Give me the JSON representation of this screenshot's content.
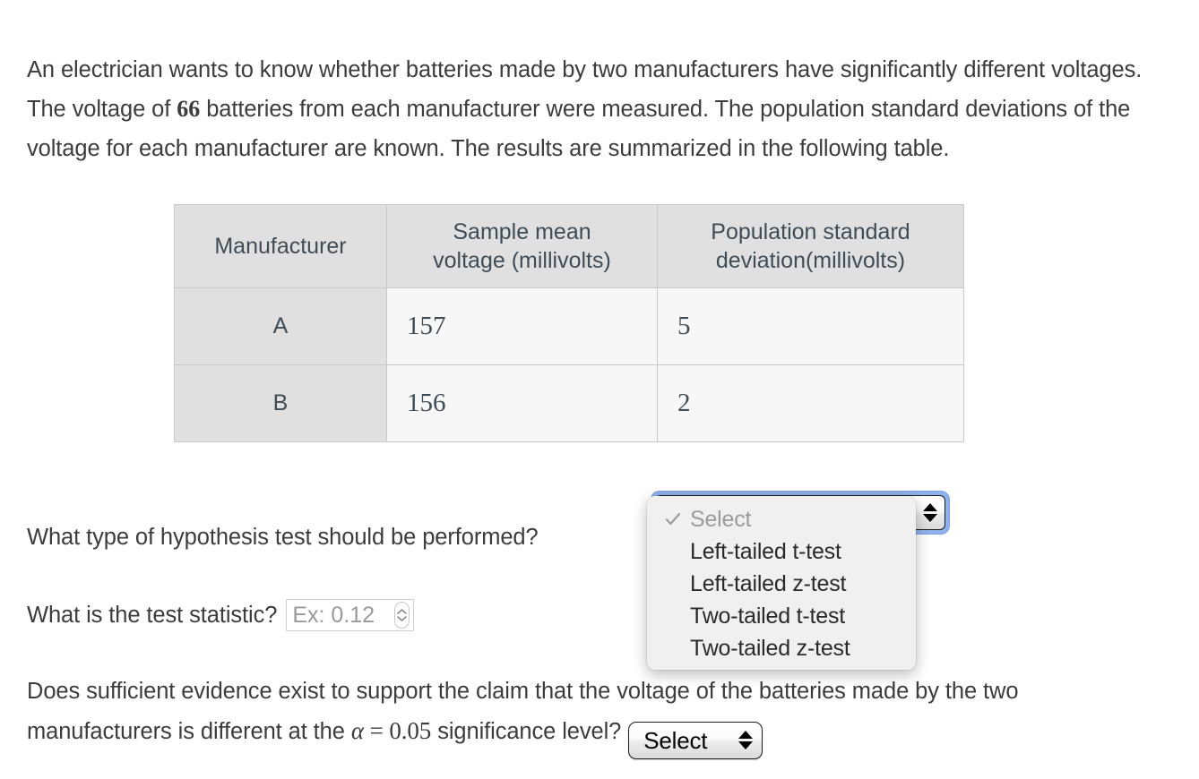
{
  "intro": {
    "part1": "An electrician wants to know whether batteries made by two manufacturers have significantly different voltages. The voltage of ",
    "sample_size": "66",
    "part2": " batteries from each manufacturer were measured. The population standard deviations of the voltage for each manufacturer are known. The results are summarized in the following table."
  },
  "table": {
    "headers": [
      "Manufacturer",
      "Sample mean voltage (millivolts)",
      "Population standard deviation(millivolts)"
    ],
    "header_lines": {
      "col1": "Manufacturer",
      "col2_line1": "Sample mean",
      "col2_line2": "voltage (millivolts)",
      "col3_line1": "Population standard",
      "col3_line2": "deviation(millivolts)"
    },
    "rows": [
      {
        "manufacturer": "A",
        "sample_mean_voltage": "157",
        "population_sd": "5"
      },
      {
        "manufacturer": "B",
        "sample_mean_voltage": "156",
        "population_sd": "2"
      }
    ]
  },
  "questions": {
    "hypothesis": {
      "text": "What type of hypothesis test should be performed?",
      "select_value": "Select"
    },
    "statistic": {
      "text": "What is the test statistic?",
      "input_placeholder": "Ex: 0.12",
      "input_value": ""
    },
    "conclusion": {
      "part1": "Does sufficient evidence exist to support the claim that the voltage of the batteries made by the two manufacturers is different at the ",
      "alpha_symbol": "α",
      "alpha_equals": "=",
      "alpha_value": "0.05",
      "part2": " significance level?",
      "select_value": "Select"
    }
  },
  "dropdown": {
    "open": true,
    "items": [
      {
        "label": "Select",
        "checked": true,
        "placeholder": true
      },
      {
        "label": "Left-tailed t-test",
        "checked": false,
        "placeholder": false
      },
      {
        "label": "Left-tailed z-test",
        "checked": false,
        "placeholder": false
      },
      {
        "label": "Two-tailed t-test",
        "checked": false,
        "placeholder": false
      },
      {
        "label": "Two-tailed z-test",
        "checked": false,
        "placeholder": false
      }
    ]
  },
  "colors": {
    "page_background": "#ffffff",
    "body_text": "#3c3c3c",
    "table_header_background": "#e0e0e0",
    "table_cell_background": "#f7f7f7",
    "table_border": "#c9c9c9",
    "table_text": "#3f4c56",
    "focus_ring": "#8fb1ec",
    "menu_background": "#f0f0f0",
    "placeholder_text": "#9b9b9b"
  }
}
